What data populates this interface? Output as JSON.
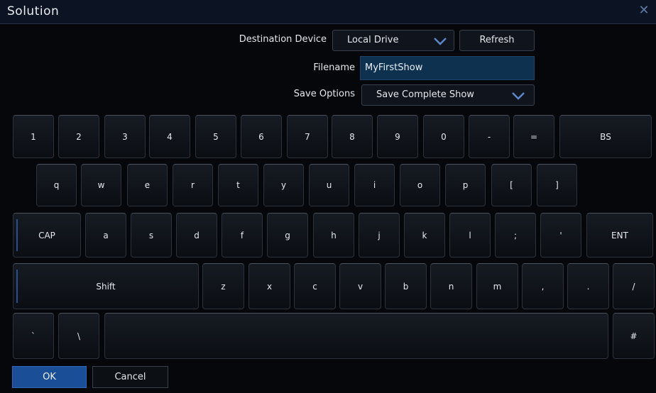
{
  "window": {
    "title": "Solution"
  },
  "form": {
    "destination_label": "Destination Device",
    "destination_value": "Local Drive",
    "refresh_label": "Refresh",
    "filename_label": "Filename",
    "filename_value": "MyFirstShow",
    "save_options_label": "Save Options",
    "save_options_value": "Save Complete Show"
  },
  "keyboard": {
    "row1": [
      "1",
      "2",
      "3",
      "4",
      "5",
      "6",
      "7",
      "8",
      "9",
      "0",
      "-",
      "=",
      "BS"
    ],
    "row2": [
      "q",
      "w",
      "e",
      "r",
      "t",
      "y",
      "u",
      "i",
      "o",
      "p",
      "[",
      "]"
    ],
    "row3": [
      "CAP",
      "a",
      "s",
      "d",
      "f",
      "g",
      "h",
      "j",
      "k",
      "l",
      ";",
      "'",
      "ENT"
    ],
    "row4": [
      "Shift",
      "z",
      "x",
      "c",
      "v",
      "b",
      "n",
      "m",
      ",",
      ".",
      "/"
    ],
    "row5": [
      "`",
      "\\",
      "",
      "#"
    ]
  },
  "footer": {
    "ok_label": "OK",
    "cancel_label": "Cancel"
  },
  "colors": {
    "accent": "#1a4e96",
    "input_bg": "#0e3150",
    "chevron": "#5f86c8",
    "background": "#06070a"
  }
}
